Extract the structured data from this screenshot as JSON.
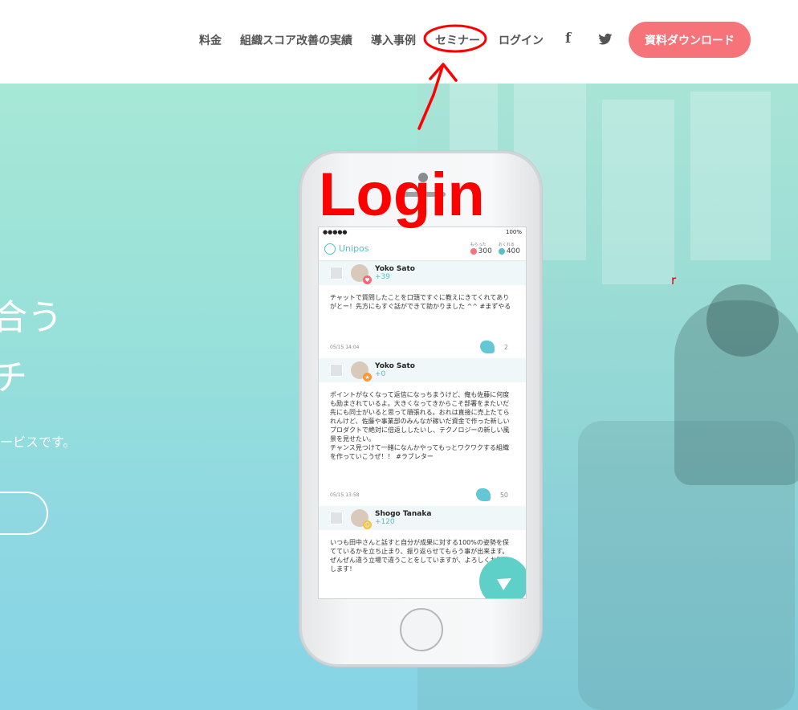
{
  "header": {
    "nav": [
      {
        "label": "料金"
      },
      {
        "label": "組織スコア改善の実績"
      },
      {
        "label": "導入事例"
      },
      {
        "label": "セミナー"
      },
      {
        "label": "ログイン"
      }
    ],
    "facebook_label": "f",
    "cta_label": "資料ダウンロード"
  },
  "hero": {
    "headline_line1": "合う",
    "headline_line2": "チ",
    "subtitle": "ービスです。"
  },
  "phone": {
    "status_carrier": "●●●●● ",
    "status_battery": "100%",
    "app_name": "Unipos",
    "received_caption": "もらった",
    "received_points": "300",
    "sent_caption": "おくれる",
    "sent_points": "400",
    "posts": [
      {
        "name": "Yoko Sato",
        "points": "+39",
        "body": "チャットで質問したことを口頭ですぐに教えにきてくれてありがとー！先方にもすぐ話ができて助かりました ^^ #まずやる",
        "date": "05/15 14:04",
        "claps": "2"
      },
      {
        "name": "Yoko Sato",
        "points": "+0",
        "body": "ポイントがなくなって返信になっちまうけど、俺も佐藤に何度も励まされているよ。大きくなってきからこそ部署をまたいだ先にも同士がいると思って頑張れる。おれは直接に売上たてられんけど、佐藤や事業部のみんなが稼いだ資金で作った新しいプロダクトで絶対に倍返ししたいし、テクノロジーの新しい風景を見せたい。\nチャンス見つけて一緒になんかやってもっとワクワクする組織を作っていこうぜ！！ #ラブレター",
        "date": "05/15 13:58",
        "claps": "50"
      },
      {
        "name": "Shogo Tanaka",
        "points": "+120",
        "body": "いつも田中さんと話すと自分が成果に対する100%の姿勢を保てているかを立ち止まり、振り返らせてもらう事が出来ます。\nぜんぜん違う立場で違うことをしていますが、よろしくお願いします！",
        "date": "",
        "claps": ""
      }
    ]
  },
  "annotations": {
    "login_text": "Login",
    "stray_text": "r",
    "color": "#ff0000"
  },
  "colors": {
    "cta": "#f57379",
    "accent": "#55c0c6",
    "hero_top": "#a7e8d6",
    "hero_bottom": "#86d4e6"
  }
}
